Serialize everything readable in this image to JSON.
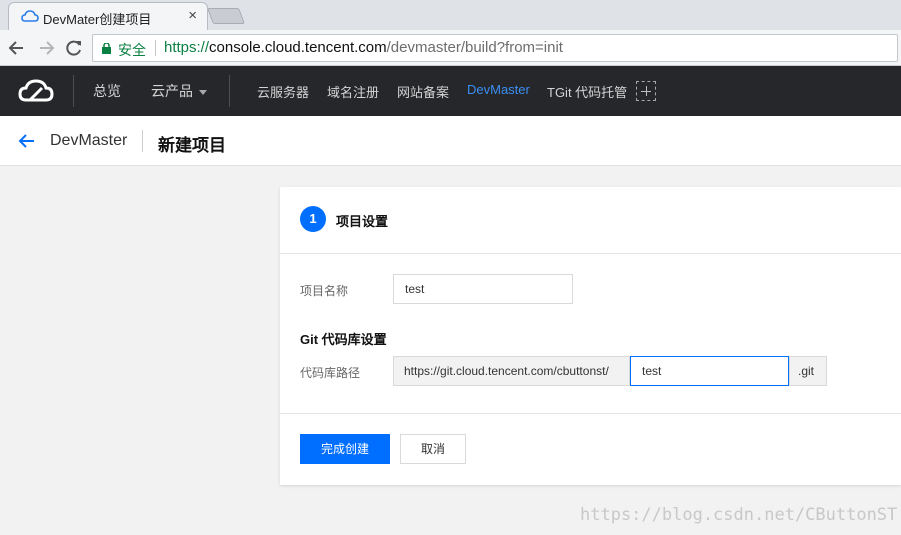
{
  "browser": {
    "tab_title": "DevMater创建项目",
    "close_glyph": "×",
    "secure_label": "安全",
    "url_protocol": "https://",
    "url_host": "console.cloud.tencent.com",
    "url_path": "/devmaster/build?from=init"
  },
  "topnav": {
    "overview": "总览",
    "products": "云产品",
    "items": [
      "云服务器",
      "域名注册",
      "网站备案",
      "DevMaster",
      "TGit 代码托管"
    ],
    "active_item": "DevMaster",
    "active_color": "#3b8ef0"
  },
  "page": {
    "breadcrumb_parent": "DevMaster",
    "title": "新建项目"
  },
  "form": {
    "step_number": "1",
    "step_title": "项目设置",
    "project_name_label": "项目名称",
    "project_name_value": "test",
    "git_section_title": "Git 代码库设置",
    "repo_path_label": "代码库路径",
    "repo_prefix": "https://git.cloud.tencent.com/cbuttonst/",
    "repo_name_value": "test",
    "repo_suffix": ".git",
    "submit_label": "完成创建",
    "cancel_label": "取消"
  },
  "colors": {
    "primary": "#006eff",
    "nav_bg": "#25272b"
  },
  "watermark": "https://blog.csdn.net/CButtonST"
}
